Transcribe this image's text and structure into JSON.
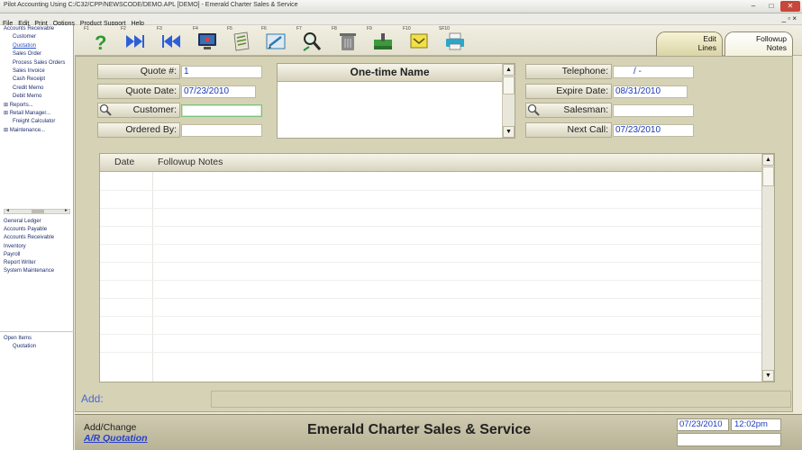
{
  "window": {
    "title": "Pilot Accounting Using C:/C32/CPP/NEWSCODE/DEMO.APL [DEMO] - Emerald Charter Sales & Service",
    "min_label": "–",
    "max_label": "□",
    "close_label": "✕",
    "mdi_controls": "_ ▫ ×"
  },
  "menu": [
    "File",
    "Edit",
    "Print",
    "Options",
    "Product Support",
    "Help"
  ],
  "sidebar": {
    "tree": [
      {
        "label": "Accounts Receivable",
        "level": 0
      },
      {
        "label": "Customer",
        "level": 1
      },
      {
        "label": "Quotation",
        "level": 1,
        "selected": true
      },
      {
        "label": "Sales Order",
        "level": 1
      },
      {
        "label": "Process Sales Orders",
        "level": 1
      },
      {
        "label": "Sales Invoice",
        "level": 1
      },
      {
        "label": "Cash Receipt",
        "level": 1
      },
      {
        "label": "Credit Memo",
        "level": 1
      },
      {
        "label": "Debit Memo",
        "level": 1
      },
      {
        "label": "⊞ Reports...",
        "level": 0
      },
      {
        "label": "⊞ Retail Manager...",
        "level": 0
      },
      {
        "label": "Freight Calculator",
        "level": 1
      },
      {
        "label": "⊞ Maintenance...",
        "level": 0
      }
    ],
    "modules": [
      "General Ledger",
      "Accounts Payable",
      "Accounts Receivable",
      "Inventory",
      "Payroll",
      "Report Writer",
      "System Maintenance"
    ],
    "open_items_title": "Open Items",
    "open_items": [
      "Quotation"
    ]
  },
  "toolbar": {
    "fkeys": [
      "F1",
      "F2",
      "F3",
      "F4",
      "F5",
      "F6",
      "F7",
      "F8",
      "F9",
      "F10",
      "SF10"
    ],
    "buttons": [
      {
        "icon": "help-icon",
        "color": "#2f9a2f"
      },
      {
        "icon": "next-record-icon",
        "color": "#2d5fd8"
      },
      {
        "icon": "previous-record-icon",
        "color": "#2d5fd8"
      },
      {
        "icon": "monitor-icon",
        "color": "#3b6fb5"
      },
      {
        "icon": "document-icon",
        "color": "#5b8a3a"
      },
      {
        "icon": "edit-icon",
        "color": "#2b7cb0"
      },
      {
        "icon": "search-icon",
        "color": "#2a8f4a"
      },
      {
        "icon": "trash-icon",
        "color": "#7d7d7d"
      },
      {
        "icon": "save-icon",
        "color": "#3b9a3b"
      },
      {
        "icon": "email-icon",
        "color": "#d9c21b"
      },
      {
        "icon": "print-icon",
        "color": "#2aa7c9"
      }
    ]
  },
  "tabs": [
    {
      "line1": "Edit",
      "line2": "Lines",
      "active": false
    },
    {
      "line1": "Followup",
      "line2": "Notes",
      "active": true
    }
  ],
  "form": {
    "quote_no": {
      "label": "Quote #:",
      "value": "1"
    },
    "quote_date": {
      "label": "Quote Date:",
      "value": "07/23/2010"
    },
    "customer": {
      "label": "Customer:",
      "value": ""
    },
    "ordered_by": {
      "label": "Ordered By:",
      "value": ""
    },
    "one_time_name": {
      "label": "One-time Name",
      "value": ""
    },
    "telephone": {
      "label": "Telephone:",
      "value": "/        -"
    },
    "expire_date": {
      "label": "Expire Date:",
      "value": "08/31/2010"
    },
    "salesman": {
      "label": "Salesman:",
      "value": ""
    },
    "next_call": {
      "label": "Next Call:",
      "value": "07/23/2010"
    }
  },
  "grid": {
    "columns": [
      "Date",
      "Followup Notes"
    ],
    "rows": []
  },
  "add_label": "Add:",
  "status": {
    "mode": "Add/Change",
    "screen": "A/R Quotation",
    "company": "Emerald Charter Sales & Service",
    "date": "07/23/2010",
    "time": "12:02pm"
  }
}
